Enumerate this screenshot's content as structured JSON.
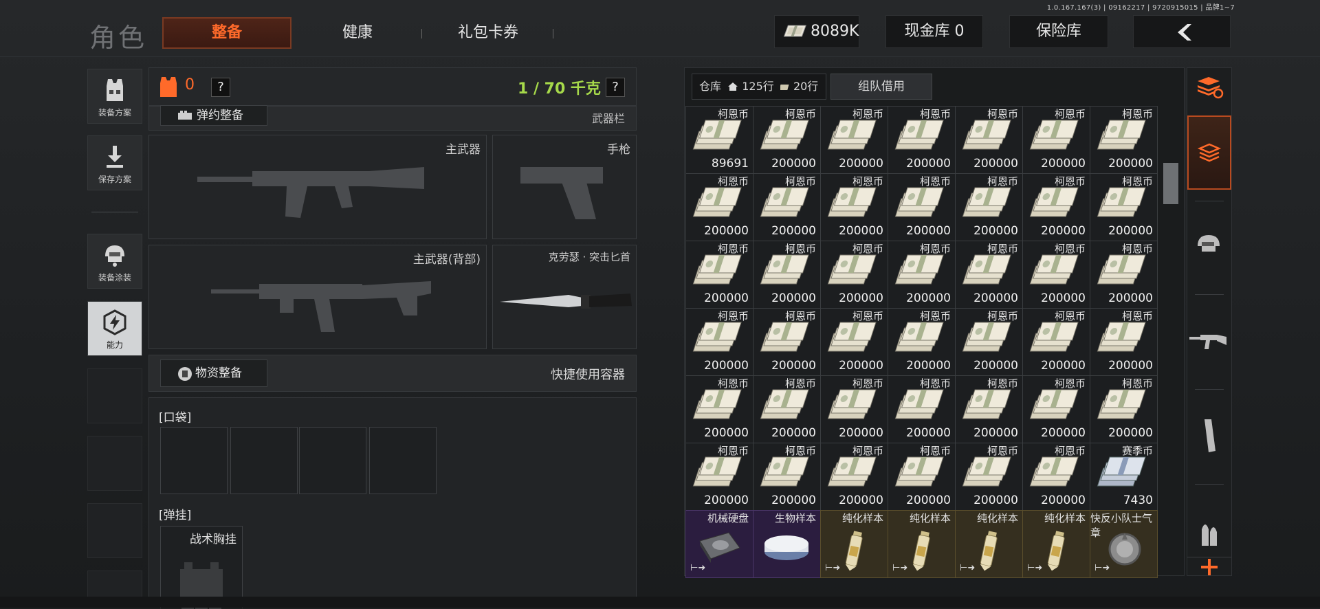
{
  "version": "1.0.167.167(3) | 09162217 | 9720915015 | 品牌1~7",
  "header": {
    "title": "角色",
    "tabs": [
      {
        "label": "整备",
        "active": true
      },
      {
        "label": "健康",
        "active": false
      },
      {
        "label": "礼包卡券",
        "active": false
      }
    ],
    "currency_value": "8089K",
    "cash_vault_label": "现金库 0",
    "safe_label": "保险库",
    "back_icon": "chevron-left-icon"
  },
  "sidebar": {
    "items": [
      {
        "label": "装备方案",
        "icon": "armor-vest-icon"
      },
      {
        "label": "保存方案",
        "icon": "download-icon"
      },
      {
        "label": "装备涂装",
        "icon": "helmet-icon"
      },
      {
        "label": "能力",
        "icon": "lightning-hexagon-icon",
        "active": true
      }
    ]
  },
  "loadout": {
    "armor_count": "0",
    "help": "?",
    "weight": "1 / 70 千克",
    "weight_color": "#a6d94a",
    "ammo_section": "弹约整备",
    "weapons_column": "武器栏",
    "primary_weapon": "主武器",
    "pistol": "手枪",
    "primary_back": "主武器(背部)",
    "melee": "克劳瑟 · 突击匕首",
    "supplies_section": "物资整备",
    "quick_container": "快捷使用容器",
    "pocket_label": "[口袋]",
    "rig_label": "[弹挂]",
    "rig_item": "战术胸挂"
  },
  "stash": {
    "label": "仓库",
    "rows_label": "125行",
    "rows2_label": "20行",
    "team_loan": "组队借用",
    "rows": [
      [
        {
          "name": "柯恩币",
          "qty": "89691"
        },
        {
          "name": "柯恩币",
          "qty": "200000"
        },
        {
          "name": "柯恩币",
          "qty": "200000"
        },
        {
          "name": "柯恩币",
          "qty": "200000"
        },
        {
          "name": "柯恩币",
          "qty": "200000"
        },
        {
          "name": "柯恩币",
          "qty": "200000"
        },
        {
          "name": "柯恩币",
          "qty": "200000"
        }
      ],
      [
        {
          "name": "柯恩币",
          "qty": "200000"
        },
        {
          "name": "柯恩币",
          "qty": "200000"
        },
        {
          "name": "柯恩币",
          "qty": "200000"
        },
        {
          "name": "柯恩币",
          "qty": "200000"
        },
        {
          "name": "柯恩币",
          "qty": "200000"
        },
        {
          "name": "柯恩币",
          "qty": "200000"
        },
        {
          "name": "柯恩币",
          "qty": "200000"
        }
      ],
      [
        {
          "name": "柯恩币",
          "qty": "200000"
        },
        {
          "name": "柯恩币",
          "qty": "200000"
        },
        {
          "name": "柯恩币",
          "qty": "200000"
        },
        {
          "name": "柯恩币",
          "qty": "200000"
        },
        {
          "name": "柯恩币",
          "qty": "200000"
        },
        {
          "name": "柯恩币",
          "qty": "200000"
        },
        {
          "name": "柯恩币",
          "qty": "200000"
        }
      ],
      [
        {
          "name": "柯恩币",
          "qty": "200000"
        },
        {
          "name": "柯恩币",
          "qty": "200000"
        },
        {
          "name": "柯恩币",
          "qty": "200000"
        },
        {
          "name": "柯恩币",
          "qty": "200000"
        },
        {
          "name": "柯恩币",
          "qty": "200000"
        },
        {
          "name": "柯恩币",
          "qty": "200000"
        },
        {
          "name": "柯恩币",
          "qty": "200000"
        }
      ],
      [
        {
          "name": "柯恩币",
          "qty": "200000"
        },
        {
          "name": "柯恩币",
          "qty": "200000"
        },
        {
          "name": "柯恩币",
          "qty": "200000"
        },
        {
          "name": "柯恩币",
          "qty": "200000"
        },
        {
          "name": "柯恩币",
          "qty": "200000"
        },
        {
          "name": "柯恩币",
          "qty": "200000"
        },
        {
          "name": "柯恩币",
          "qty": "200000"
        }
      ],
      [
        {
          "name": "柯恩币",
          "qty": "200000"
        },
        {
          "name": "柯恩币",
          "qty": "200000"
        },
        {
          "name": "柯恩币",
          "qty": "200000"
        },
        {
          "name": "柯恩币",
          "qty": "200000"
        },
        {
          "name": "柯恩币",
          "qty": "200000"
        },
        {
          "name": "柯恩币",
          "qty": "200000"
        },
        {
          "name": "赛季币",
          "qty": "7430"
        }
      ],
      [
        {
          "name": "机械硬盘",
          "qty": ""
        },
        {
          "name": "生物样本",
          "qty": ""
        },
        {
          "name": "纯化样本",
          "qty": ""
        },
        {
          "name": "纯化样本",
          "qty": ""
        },
        {
          "name": "纯化样本",
          "qty": ""
        },
        {
          "name": "纯化样本",
          "qty": ""
        },
        {
          "name": "快反小队士气章",
          "qty": ""
        }
      ]
    ],
    "bottom_row_rarity": [
      "purple",
      "purple",
      "gold",
      "gold",
      "gold",
      "gold",
      "gold"
    ]
  },
  "rightbar": {
    "items": [
      "sort-icon",
      "stash-layer-icon",
      "helmet-icon",
      "rifle-icon",
      "magazine-icon",
      "ammo-icon",
      "add-icon"
    ]
  },
  "colors": {
    "accent": "#ff6a2a",
    "weight": "#a6d94a"
  }
}
